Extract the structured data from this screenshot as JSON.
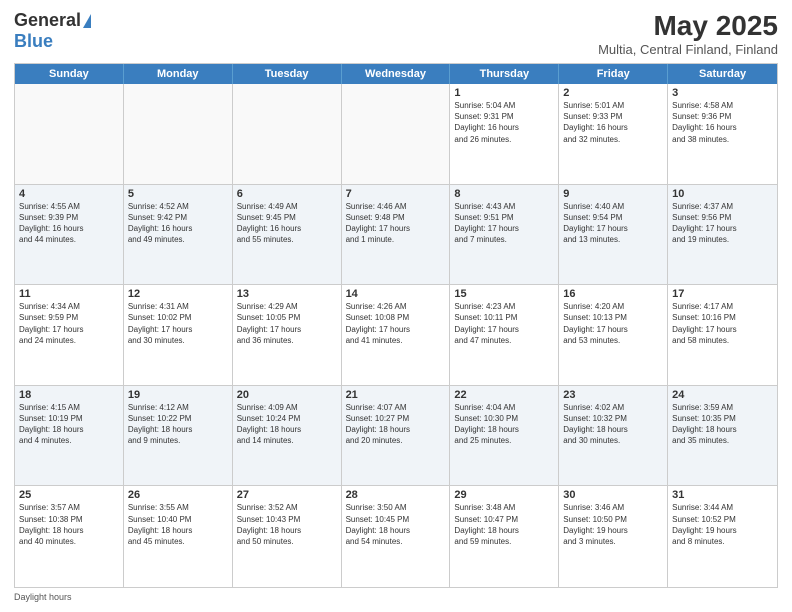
{
  "logo": {
    "general": "General",
    "blue": "Blue"
  },
  "title": "May 2025",
  "subtitle": "Multia, Central Finland, Finland",
  "days": [
    "Sunday",
    "Monday",
    "Tuesday",
    "Wednesday",
    "Thursday",
    "Friday",
    "Saturday"
  ],
  "footer": "Daylight hours",
  "weeks": [
    [
      {
        "date": "",
        "info": ""
      },
      {
        "date": "",
        "info": ""
      },
      {
        "date": "",
        "info": ""
      },
      {
        "date": "",
        "info": ""
      },
      {
        "date": "1",
        "info": "Sunrise: 5:04 AM\nSunset: 9:31 PM\nDaylight: 16 hours\nand 26 minutes."
      },
      {
        "date": "2",
        "info": "Sunrise: 5:01 AM\nSunset: 9:33 PM\nDaylight: 16 hours\nand 32 minutes."
      },
      {
        "date": "3",
        "info": "Sunrise: 4:58 AM\nSunset: 9:36 PM\nDaylight: 16 hours\nand 38 minutes."
      }
    ],
    [
      {
        "date": "4",
        "info": "Sunrise: 4:55 AM\nSunset: 9:39 PM\nDaylight: 16 hours\nand 44 minutes."
      },
      {
        "date": "5",
        "info": "Sunrise: 4:52 AM\nSunset: 9:42 PM\nDaylight: 16 hours\nand 49 minutes."
      },
      {
        "date": "6",
        "info": "Sunrise: 4:49 AM\nSunset: 9:45 PM\nDaylight: 16 hours\nand 55 minutes."
      },
      {
        "date": "7",
        "info": "Sunrise: 4:46 AM\nSunset: 9:48 PM\nDaylight: 17 hours\nand 1 minute."
      },
      {
        "date": "8",
        "info": "Sunrise: 4:43 AM\nSunset: 9:51 PM\nDaylight: 17 hours\nand 7 minutes."
      },
      {
        "date": "9",
        "info": "Sunrise: 4:40 AM\nSunset: 9:54 PM\nDaylight: 17 hours\nand 13 minutes."
      },
      {
        "date": "10",
        "info": "Sunrise: 4:37 AM\nSunset: 9:56 PM\nDaylight: 17 hours\nand 19 minutes."
      }
    ],
    [
      {
        "date": "11",
        "info": "Sunrise: 4:34 AM\nSunset: 9:59 PM\nDaylight: 17 hours\nand 24 minutes."
      },
      {
        "date": "12",
        "info": "Sunrise: 4:31 AM\nSunset: 10:02 PM\nDaylight: 17 hours\nand 30 minutes."
      },
      {
        "date": "13",
        "info": "Sunrise: 4:29 AM\nSunset: 10:05 PM\nDaylight: 17 hours\nand 36 minutes."
      },
      {
        "date": "14",
        "info": "Sunrise: 4:26 AM\nSunset: 10:08 PM\nDaylight: 17 hours\nand 41 minutes."
      },
      {
        "date": "15",
        "info": "Sunrise: 4:23 AM\nSunset: 10:11 PM\nDaylight: 17 hours\nand 47 minutes."
      },
      {
        "date": "16",
        "info": "Sunrise: 4:20 AM\nSunset: 10:13 PM\nDaylight: 17 hours\nand 53 minutes."
      },
      {
        "date": "17",
        "info": "Sunrise: 4:17 AM\nSunset: 10:16 PM\nDaylight: 17 hours\nand 58 minutes."
      }
    ],
    [
      {
        "date": "18",
        "info": "Sunrise: 4:15 AM\nSunset: 10:19 PM\nDaylight: 18 hours\nand 4 minutes."
      },
      {
        "date": "19",
        "info": "Sunrise: 4:12 AM\nSunset: 10:22 PM\nDaylight: 18 hours\nand 9 minutes."
      },
      {
        "date": "20",
        "info": "Sunrise: 4:09 AM\nSunset: 10:24 PM\nDaylight: 18 hours\nand 14 minutes."
      },
      {
        "date": "21",
        "info": "Sunrise: 4:07 AM\nSunset: 10:27 PM\nDaylight: 18 hours\nand 20 minutes."
      },
      {
        "date": "22",
        "info": "Sunrise: 4:04 AM\nSunset: 10:30 PM\nDaylight: 18 hours\nand 25 minutes."
      },
      {
        "date": "23",
        "info": "Sunrise: 4:02 AM\nSunset: 10:32 PM\nDaylight: 18 hours\nand 30 minutes."
      },
      {
        "date": "24",
        "info": "Sunrise: 3:59 AM\nSunset: 10:35 PM\nDaylight: 18 hours\nand 35 minutes."
      }
    ],
    [
      {
        "date": "25",
        "info": "Sunrise: 3:57 AM\nSunset: 10:38 PM\nDaylight: 18 hours\nand 40 minutes."
      },
      {
        "date": "26",
        "info": "Sunrise: 3:55 AM\nSunset: 10:40 PM\nDaylight: 18 hours\nand 45 minutes."
      },
      {
        "date": "27",
        "info": "Sunrise: 3:52 AM\nSunset: 10:43 PM\nDaylight: 18 hours\nand 50 minutes."
      },
      {
        "date": "28",
        "info": "Sunrise: 3:50 AM\nSunset: 10:45 PM\nDaylight: 18 hours\nand 54 minutes."
      },
      {
        "date": "29",
        "info": "Sunrise: 3:48 AM\nSunset: 10:47 PM\nDaylight: 18 hours\nand 59 minutes."
      },
      {
        "date": "30",
        "info": "Sunrise: 3:46 AM\nSunset: 10:50 PM\nDaylight: 19 hours\nand 3 minutes."
      },
      {
        "date": "31",
        "info": "Sunrise: 3:44 AM\nSunset: 10:52 PM\nDaylight: 19 hours\nand 8 minutes."
      }
    ]
  ]
}
